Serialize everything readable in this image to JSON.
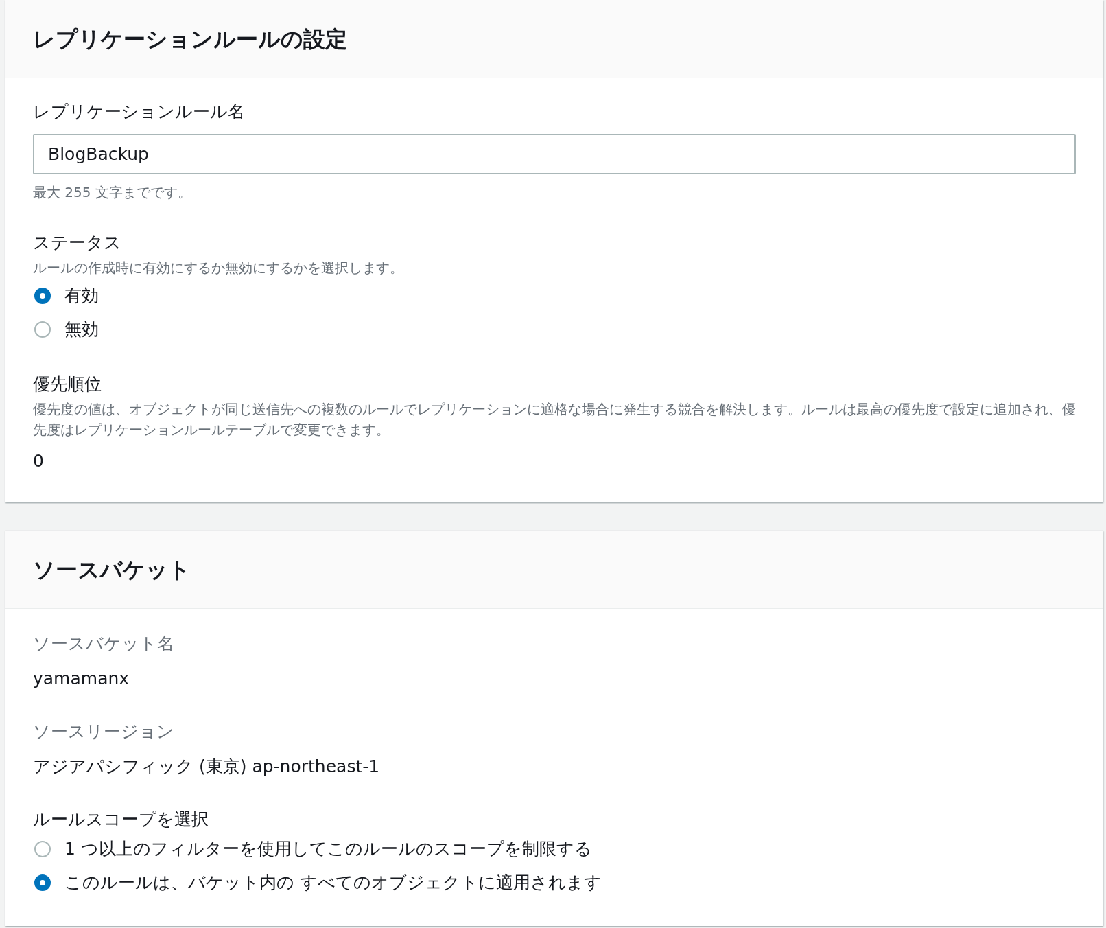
{
  "sections": [
    {
      "title": "レプリケーションルールの設定",
      "fields": [
        {
          "kind": "text_input",
          "label": "レプリケーションルール名",
          "value": "BlogBackup",
          "hint": "最大 255 文字までです。"
        },
        {
          "kind": "radio_group",
          "label": "ステータス",
          "description": "ルールの作成時に有効にするか無効にするかを選択します。",
          "options": [
            {
              "label": "有効",
              "selected": true
            },
            {
              "label": "無効",
              "selected": false
            }
          ]
        },
        {
          "kind": "static",
          "label": "優先順位",
          "description": "優先度の値は、オブジェクトが同じ送信先への複数のルールでレプリケーションに適格な場合に発生する競合を解決します。ルールは最高の優先度で設定に追加され、優先度はレプリケーションルールテーブルで変更できます。",
          "value": "0"
        }
      ]
    },
    {
      "title": "ソースバケット",
      "fields": [
        {
          "kind": "key_value",
          "label": "ソースバケット名",
          "value": "yamamanx"
        },
        {
          "kind": "key_value",
          "label": "ソースリージョン",
          "value": "アジアパシフィック (東京) ap-northeast-1"
        },
        {
          "kind": "radio_group",
          "label": "ルールスコープを選択",
          "options": [
            {
              "label": "1 つ以上のフィルターを使用してこのルールのスコープを制限する",
              "selected": false
            },
            {
              "label": "このルールは、バケット内の すべてのオブジェクトに適用されます",
              "selected": true
            }
          ]
        }
      ]
    }
  ]
}
